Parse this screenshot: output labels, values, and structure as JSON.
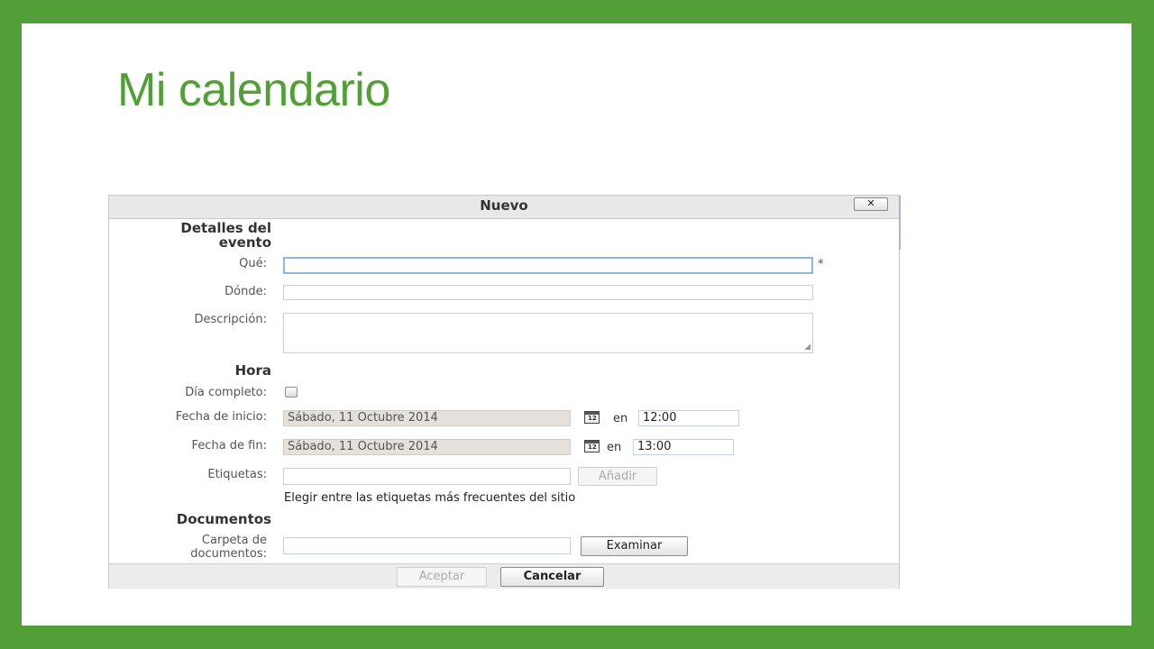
{
  "slide": {
    "title": "Mi calendario"
  },
  "dialog": {
    "title": "Nuevo",
    "close_label": "✕",
    "sections": {
      "event_details": "Detalles del evento",
      "time": "Hora",
      "documents": "Documentos"
    },
    "fields": {
      "que": {
        "label": "Qué:",
        "value": "",
        "required_mark": "*"
      },
      "donde": {
        "label": "Dónde:",
        "value": ""
      },
      "descripcion": {
        "label": "Descripción:",
        "value": ""
      },
      "dia_completo": {
        "label": "Día completo:",
        "checked": false
      },
      "fecha_inicio": {
        "label": "Fecha de inicio:",
        "date": "Sábado, 11 Octubre 2014",
        "en": "en",
        "time": "12:00"
      },
      "fecha_fin": {
        "label": "Fecha de fin:",
        "date": "Sábado, 11 Octubre 2014",
        "en": "en",
        "time": "13:00"
      },
      "etiquetas": {
        "label": "Etiquetas:",
        "value": "",
        "add_button": "Añadir",
        "help": "Elegir entre las etiquetas más frecuentes del sitio"
      },
      "carpeta": {
        "label": "Carpeta de documentos:",
        "value": "",
        "browse_button": "Examinar"
      }
    },
    "calendar_icon_text": "12",
    "footer": {
      "accept": "Aceptar",
      "cancel": "Cancelar"
    }
  }
}
